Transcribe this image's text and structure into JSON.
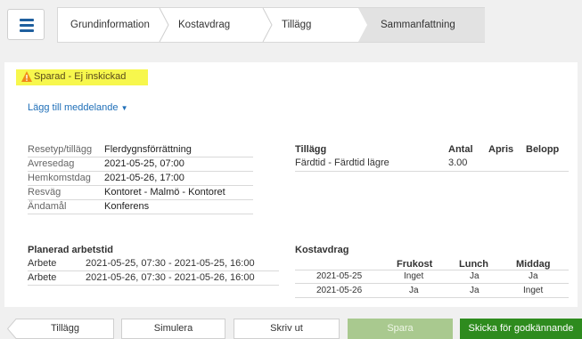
{
  "nav": {
    "steps": [
      "Grundinformation",
      "Kostavdrag",
      "Tillägg",
      "Sammanfattning"
    ],
    "active_step": "Sammanfattning"
  },
  "status": {
    "text": "Sparad - Ej inskickad",
    "color": "#f7f74d",
    "icon": "warning-icon"
  },
  "add_message": {
    "label": "Lägg till meddelande",
    "icon": "caret-down-icon"
  },
  "summary": [
    {
      "key": "Resetyp/tillägg",
      "value": "Flerdygnsförrättning"
    },
    {
      "key": "Avresedag",
      "value": "2021-05-25, 07:00"
    },
    {
      "key": "Hemkomstdag",
      "value": "2021-05-26, 17:00"
    },
    {
      "key": "Resväg",
      "value": "Kontoret - Malmö - Kontoret"
    },
    {
      "key": "Ändamål",
      "value": "Konferens"
    }
  ],
  "tillagg": {
    "headers": [
      "Tillägg",
      "Antal",
      "Apris",
      "Belopp"
    ],
    "rows": [
      {
        "name": "Färdtid - Färdtid lägre",
        "antal": "3.00",
        "apris": "",
        "belopp": ""
      }
    ]
  },
  "arbetstid": {
    "title": "Planerad arbetstid",
    "rows": [
      {
        "label": "Arbete",
        "value": "2021-05-25, 07:30 - 2021-05-25, 16:00"
      },
      {
        "label": "Arbete",
        "value": "2021-05-26, 07:30 - 2021-05-26, 16:00"
      }
    ]
  },
  "kostavdrag": {
    "title": "Kostavdrag",
    "headers": [
      "Frukost",
      "Lunch",
      "Middag"
    ],
    "rows": [
      {
        "date": "2021-05-25",
        "frukost": "Inget",
        "lunch": "Ja",
        "middag": "Ja"
      },
      {
        "date": "2021-05-26",
        "frukost": "Ja",
        "lunch": "Ja",
        "middag": "Inget"
      }
    ]
  },
  "buttons": {
    "back": "Tillägg",
    "simulate": "Simulera",
    "print": "Skriv ut",
    "save": "Spara",
    "send": "Skicka för godkännande"
  },
  "colors": {
    "accent": "#1f5f9e",
    "link": "#1f6fb8",
    "send": "#2e8b1e",
    "save_disabled": "#a9c98f"
  }
}
